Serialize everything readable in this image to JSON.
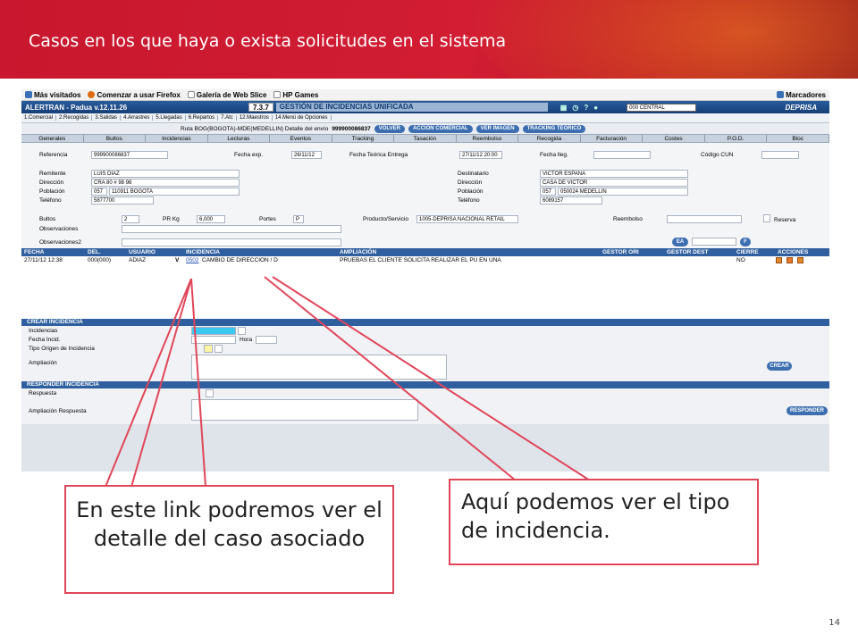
{
  "slide": {
    "title": "Casos en los que haya o exista solicitudes en el sistema",
    "page_number": "14",
    "callout_left": "En este link podremos ver el detalle del caso asociado",
    "callout_right": "Aquí podemos ver el tipo de incidencia."
  },
  "browser": {
    "bookmarks": [
      "Más visitados",
      "Comenzar a usar Firefox",
      "Galería de Web Slice",
      "HP Games"
    ],
    "bookmarks_right": "Marcadores"
  },
  "app": {
    "name": "ALERTRAN - Padua  v.12.11.26",
    "version": "7.3.7",
    "module": "GESTIÓN DE INCIDENCIAS UNIFICADA",
    "center_select": "000 CENTRAL",
    "logo": "DEPRISA",
    "menu": [
      "1.Comercial",
      "2.Recogidas",
      "3.Salidas",
      "4.Arrastres",
      "5.Llegadas",
      "6.Repartos",
      "7.Atc",
      "12.Maestros",
      "14.Menú de Opciones"
    ],
    "route_text": "Ruta BOG(BOGOTA)-MDE(MEDELLIN)  Detalle del envío",
    "shipment": "999900086837",
    "route_buttons": [
      "VOLVER",
      "ACCIÓN COMERCIAL",
      "VER IMAGEN",
      "TRACKING TEÓRICO"
    ],
    "tabs": [
      "Generales",
      "Bultos",
      "Incidencias",
      "Lecturas",
      "Eventos",
      "Tracking",
      "Tasación",
      "Reembolso",
      "Recogida",
      "Facturación",
      "Costes",
      "P.O.D.",
      "Bloc"
    ]
  },
  "form": {
    "referencia_label": "Referencia",
    "referencia": "999900086837",
    "fecha_exp_label": "Fecha exp.",
    "fecha_exp": "26/11/12",
    "fecha_teorica_label": "Fecha Teórica Entrega",
    "fecha_teorica": "27/11/12 20:00",
    "fecha_lleg_label": "Fecha lleg.",
    "codigo_cun_label": "Código CUN",
    "remitente_label": "Remitente",
    "remitente": "LUIS DIAZ",
    "direccion_label": "Dirección",
    "direccion": "CRA 80 # 98 98",
    "poblacion_label": "Población",
    "poblacion_code": "057",
    "poblacion": "110911 BOGOTA",
    "telefono_label": "Teléfono",
    "telefono": "5877700",
    "destinatario_label": "Destinatario",
    "destinatario": "VICTOR ESPAÑA",
    "direccion2": "CASA DE VICTOR",
    "poblacion2_code": "057",
    "poblacion2": "050024 MEDELLIN",
    "telefono2": "6089157",
    "bultos_label": "Bultos",
    "bultos": "2",
    "pr_kg_label": "PR Kg",
    "pr_kg": "6,000",
    "portes_label": "Portes",
    "portes": "P",
    "producto_label": "Producto/Servicio",
    "producto": "1005-DEPRISA NACIONAL RETAIL",
    "reembolso_label": "Reembolso",
    "reserva_label": "Reserva",
    "observaciones_label": "Observaciones",
    "observaciones2_label": "Observaciones2",
    "ea_button": "EA",
    "f_button": "F"
  },
  "grid": {
    "headers": [
      "FECHA",
      "DEL.",
      "USUARIO",
      "INCIDENCIA",
      "AMPLIACIÓN",
      "GESTOR ORI",
      "GESTOR DEST",
      "CIERRE",
      "ACCIONES"
    ],
    "row": {
      "fecha": "27/11/12 12:38",
      "del": "000(000)",
      "usuario": "ADIAZ",
      "flag": "V",
      "link": "0502",
      "incidencia": "CAMBIO DE DIRECCION / D",
      "ampliacion": "PRUEBAS EL CLIENTE SOLICITA REALIZAR EL PU EN UNA",
      "cierre": "NO"
    }
  },
  "crear": {
    "title": "CREAR INCIDENCIA",
    "incidencias_label": "Incidencias",
    "fecha_label": "Fecha Incid.",
    "hora_label": "Hora",
    "tipo_label": "Tipo Origen de Incidencia",
    "ampliacion_label": "Ampliación",
    "crear_button": "CREAR"
  },
  "responder": {
    "title": "RESPONDER INCIDENCIA",
    "respuesta_label": "Respuesta",
    "ampliacion_label": "Ampliación Respuesta",
    "responder_button": "RESPONDER"
  }
}
